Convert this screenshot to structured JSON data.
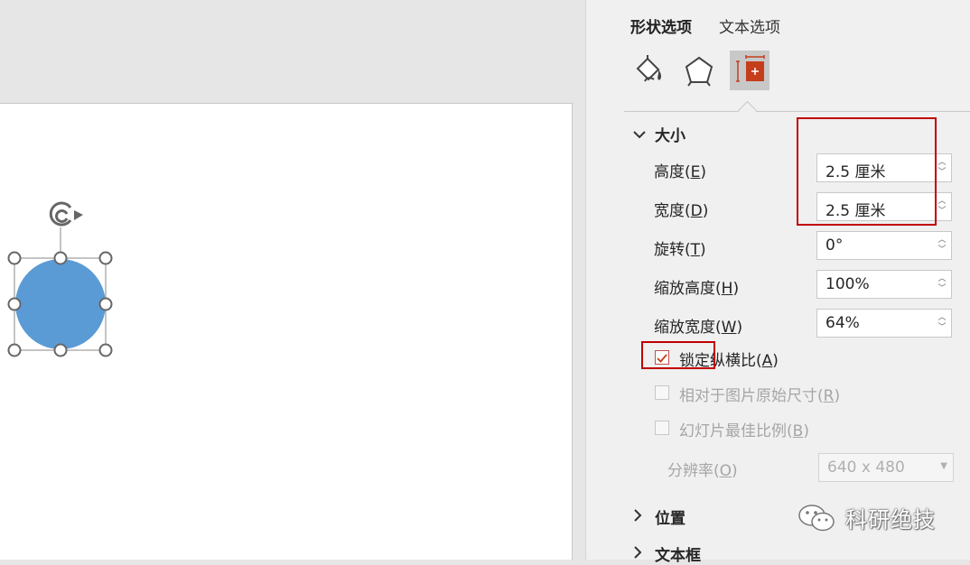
{
  "pane": {
    "tabs": [
      "形状选项",
      "文本选项"
    ],
    "icons": [
      "fill-line-icon",
      "effects-pentagon-icon",
      "size-properties-icon"
    ]
  },
  "size_section": {
    "header": "大小",
    "height": {
      "label": "高度(",
      "key": "E",
      "label_end": ")",
      "value": "2.5 厘米"
    },
    "width": {
      "label": "宽度(",
      "key": "D",
      "label_end": ")",
      "value": "2.5 厘米"
    },
    "rotation": {
      "label": "旋转(",
      "key": "T",
      "label_end": ")",
      "value": "0°"
    },
    "scale_height": {
      "label": "缩放高度(",
      "key": "H",
      "label_end": ")",
      "value": "100%"
    },
    "scale_width": {
      "label": "缩放宽度(",
      "key": "W",
      "label_end": ")",
      "value": "64%"
    },
    "lock_aspect": {
      "label": "锁定纵横比(",
      "key": "A",
      "label_end": ")",
      "checked": true
    },
    "relative_original": {
      "label": "相对于图片原始尺寸(",
      "key": "R",
      "label_end": ")",
      "checked": false
    },
    "best_scale": {
      "label": "幻灯片最佳比例(",
      "key": "B",
      "label_end": ")",
      "checked": false
    },
    "resolution": {
      "label": "分辨率(",
      "key": "O",
      "label_end": ")",
      "value": "640 x 480"
    }
  },
  "position_section": {
    "header": "位置"
  },
  "textbox_section": {
    "header": "文本框"
  },
  "watermark": "科研绝技",
  "colors": {
    "shape_fill": "#5b9bd5",
    "highlight": "#c00000",
    "accent_icon": "#c43e1c"
  }
}
